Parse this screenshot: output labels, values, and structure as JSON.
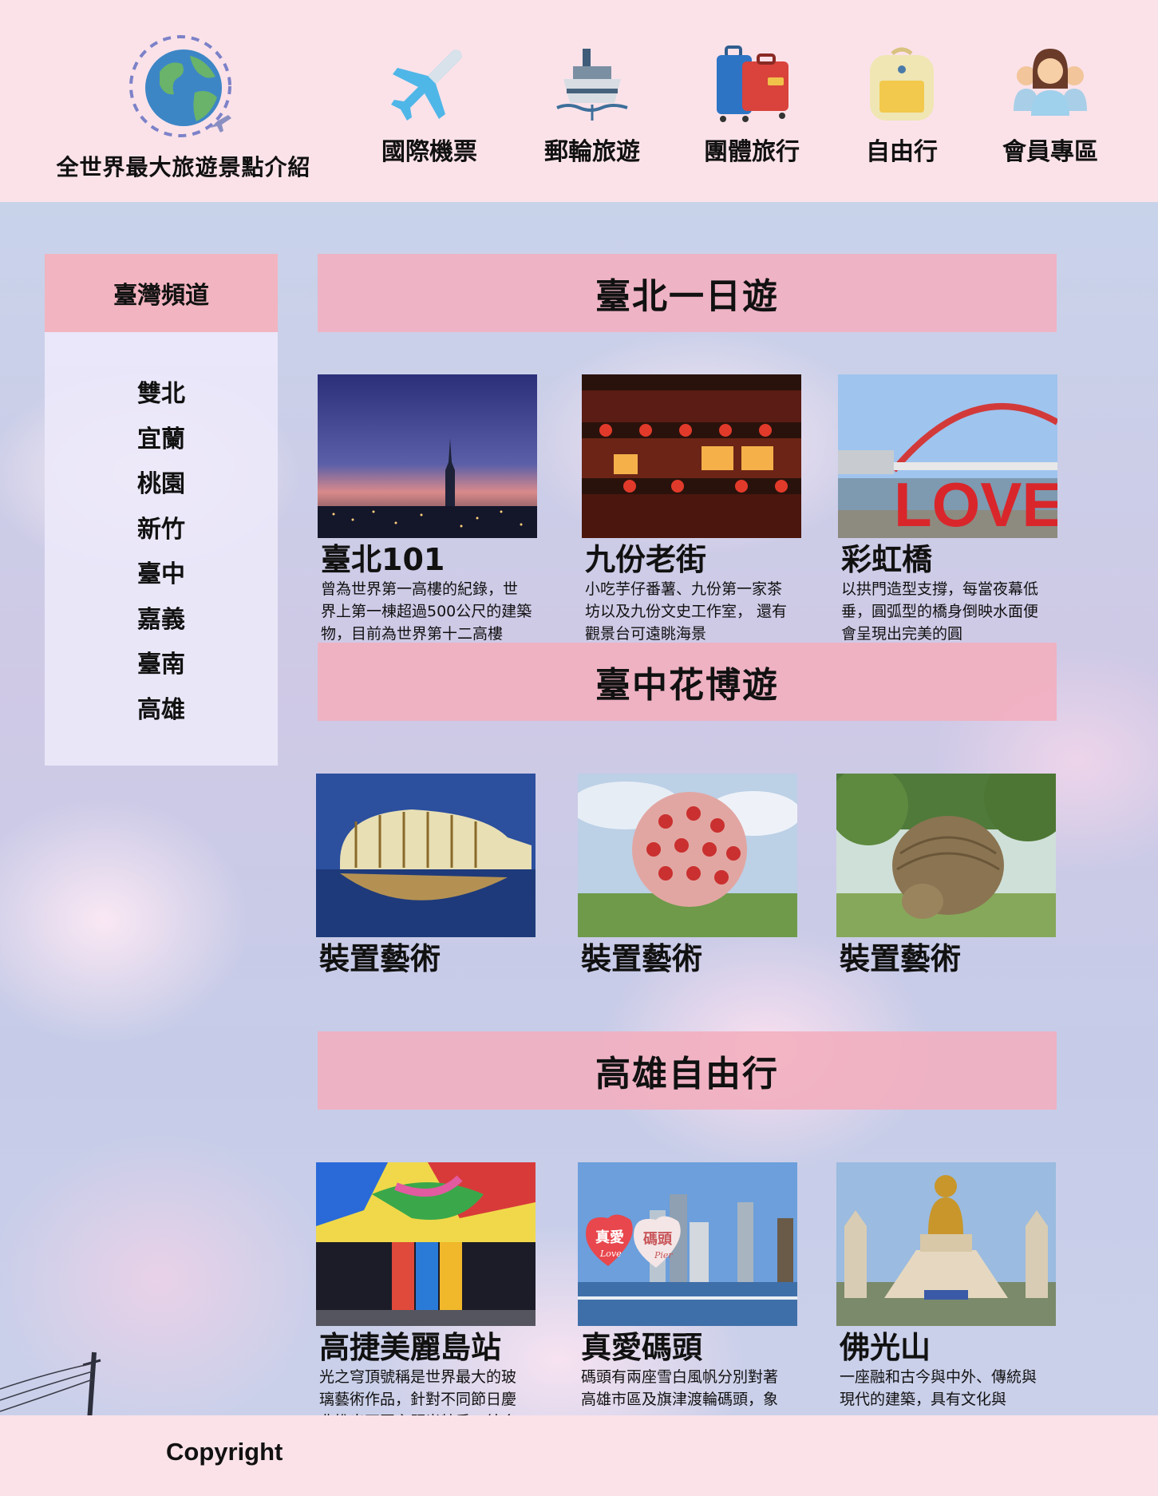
{
  "header": {
    "logo_text": "全世界最大旅遊景點介紹",
    "nav": [
      {
        "label": "國際機票",
        "icon": "airplane-icon"
      },
      {
        "label": "郵輪旅遊",
        "icon": "cruise-ship-icon"
      },
      {
        "label": "團體旅行",
        "icon": "luggage-icon"
      },
      {
        "label": "自由行",
        "icon": "backpack-icon"
      },
      {
        "label": "會員專區",
        "icon": "members-icon"
      }
    ]
  },
  "sidebar": {
    "title": "臺灣頻道",
    "items": [
      "雙北",
      "宜蘭",
      "桃園",
      "新竹",
      "臺中",
      "嘉義",
      "臺南",
      "高雄"
    ]
  },
  "sections": [
    {
      "title": "臺北一日遊",
      "cards": [
        {
          "title": "臺北101",
          "desc": "曾為世界第一高樓的紀錄，世界上第一棟超過500公尺的建築物，目前為世界第十二高樓"
        },
        {
          "title": "九份老街",
          "desc": "小吃芋仔番薯、九份第一家茶坊以及九份文史工作室， 還有觀景台可遠眺海景"
        },
        {
          "title": "彩虹橋",
          "desc": "以拱門造型支撐，每當夜幕低垂，圓弧型的橋身倒映水面便會呈現出完美的圓"
        }
      ]
    },
    {
      "title": "臺中花博遊",
      "cards": [
        {
          "title": "裝置藝術",
          "desc": ""
        },
        {
          "title": "裝置藝術",
          "desc": ""
        },
        {
          "title": "裝置藝術",
          "desc": ""
        }
      ]
    },
    {
      "title": "高雄自由行",
      "cards": [
        {
          "title": "高捷美麗島站",
          "desc": "光之穹頂號稱是世界最大的玻璃藝術作品，針對不同節日慶典推出不同主題光特秀，結合"
        },
        {
          "title": "真愛碼頭",
          "desc": "碼頭有兩座雪白風帆分別對著高雄市區及旗津渡輪碼頭，象"
        },
        {
          "title": "佛光山",
          "desc": "一座融和古今與中外、傳統與現代的建築，具有文化與"
        }
      ]
    }
  ],
  "photo_text": {
    "love_sign": "LOVE",
    "heart_left": "真愛",
    "heart_right": "碼頭",
    "heart_script": "Love",
    "heart_script_right": "Pier"
  },
  "footer": {
    "copyright": "Copyright"
  },
  "colors": {
    "header_bg": "#fbe2e9",
    "section_header": "#f2aebe",
    "sidebar_head": "#f2b4c0",
    "sidebar_body": "#ebe8fa"
  }
}
